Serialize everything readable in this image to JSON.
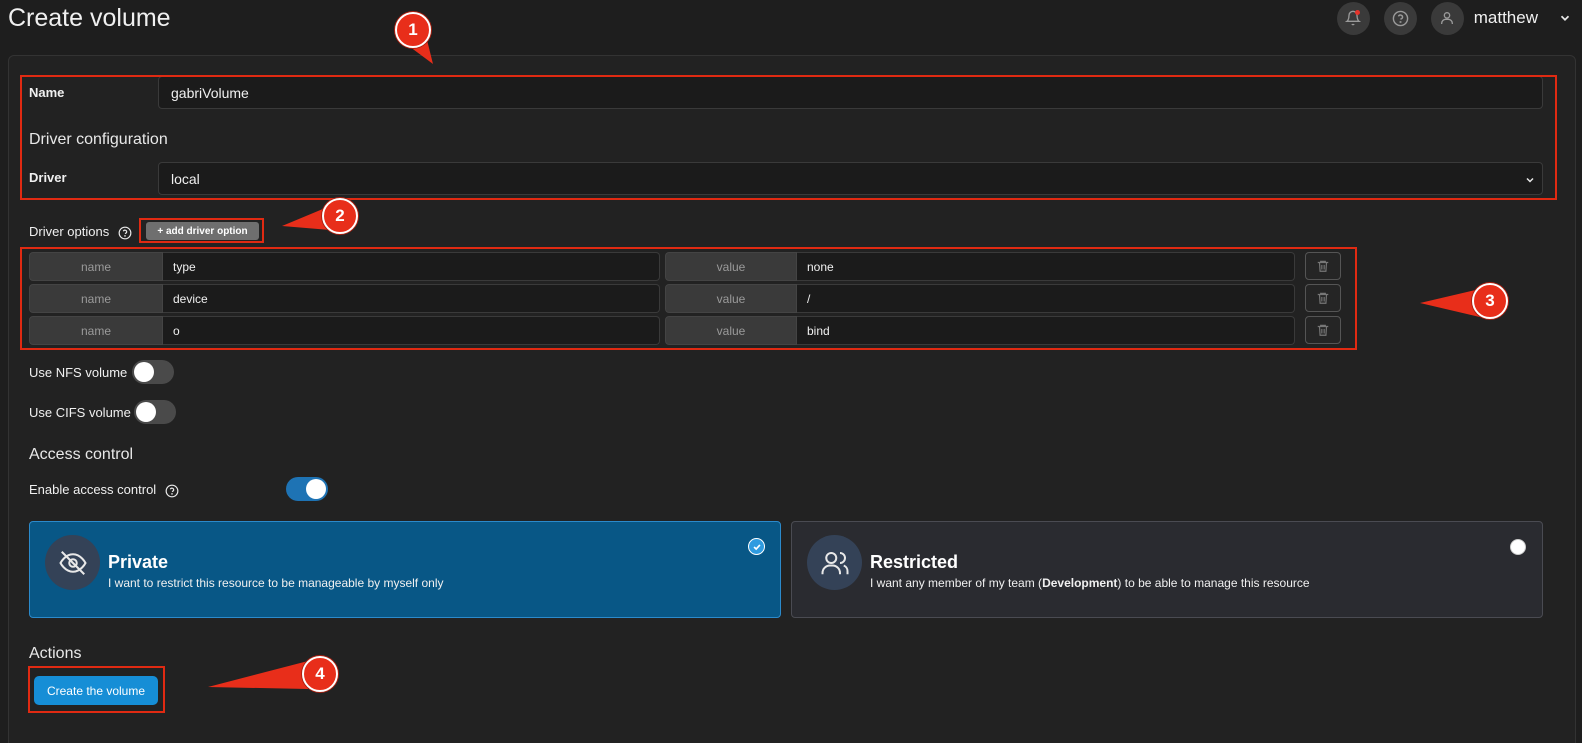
{
  "page": {
    "title": "Create volume"
  },
  "topbar": {
    "username": "matthew"
  },
  "form": {
    "name_label": "Name",
    "name_value": "gabriVolume",
    "driver_config_title": "Driver configuration",
    "driver_label": "Driver",
    "driver_value": "local",
    "driver_options_label": "Driver options",
    "add_option_label": "+ add driver option",
    "name_addon": "name",
    "value_addon": "value",
    "options": [
      {
        "name": "type",
        "value": "none"
      },
      {
        "name": "device",
        "value": "/"
      },
      {
        "name": "o",
        "value": "bind"
      }
    ],
    "nfs_label": "Use NFS volume",
    "cifs_label": "Use CIFS volume"
  },
  "access": {
    "title": "Access control",
    "enable_label": "Enable access control",
    "enabled": true,
    "private_title": "Private",
    "private_desc": "I want to restrict this resource to be manageable by myself only",
    "restricted_title": "Restricted",
    "restricted_desc_pre": "I want any member of my team (",
    "restricted_team": "Development",
    "restricted_desc_post": ") to be able to manage this resource",
    "selected": "Private"
  },
  "actions": {
    "title": "Actions",
    "create_label": "Create the volume"
  },
  "annotations": [
    "1",
    "2",
    "3",
    "4"
  ],
  "colors": {
    "accent": "#168ed6",
    "highlight": "#e02a12",
    "private_bg": "#085786"
  }
}
